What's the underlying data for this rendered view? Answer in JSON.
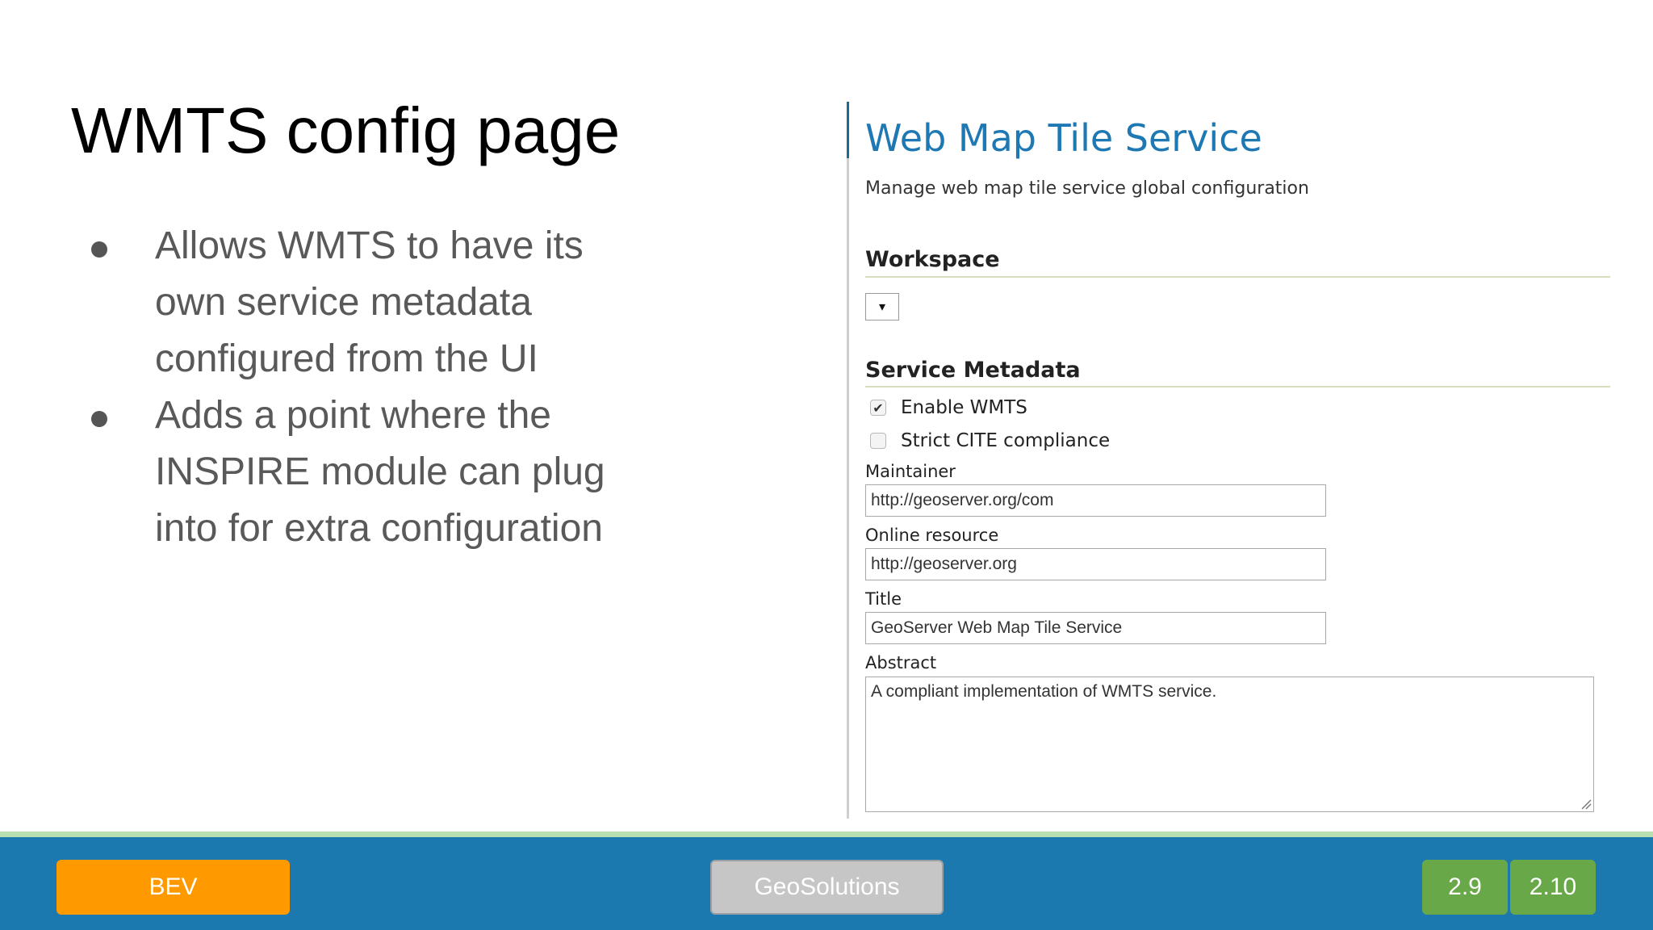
{
  "slide": {
    "title": "WMTS config page",
    "bullets": [
      "Allows WMTS to have its own service metadata configured from the UI",
      "Adds a point where the INSPIRE module can plug into for extra configuration"
    ]
  },
  "screenshot": {
    "heading": "Web Map Tile Service",
    "subtitle": "Manage web map tile service global configuration",
    "workspace_section": "Workspace",
    "workspace_select_value": "▾",
    "metadata_section": "Service Metadata",
    "checkboxes": [
      {
        "label": "Enable WMTS",
        "checked": true
      },
      {
        "label": "Strict CITE compliance",
        "checked": false
      }
    ],
    "fields": {
      "maintainer": {
        "label": "Maintainer",
        "value": "http://geoserver.org/com"
      },
      "online_resource": {
        "label": "Online resource",
        "value": "http://geoserver.org"
      },
      "title": {
        "label": "Title",
        "value": "GeoServer Web Map Tile Service"
      },
      "abstract": {
        "label": "Abstract",
        "value": "A compliant implementation of WMTS service."
      }
    }
  },
  "footer": {
    "tags": {
      "bev": "BEV",
      "geosolutions": "GeoSolutions",
      "v29": "2.9",
      "v210": "2.10"
    }
  },
  "colors": {
    "heading_blue": "#1e78b4",
    "footer_blue": "#1c79b0",
    "bev_orange": "#ff9900",
    "version_green": "#68a848",
    "geosolutions_gray": "#c6c6c6"
  }
}
